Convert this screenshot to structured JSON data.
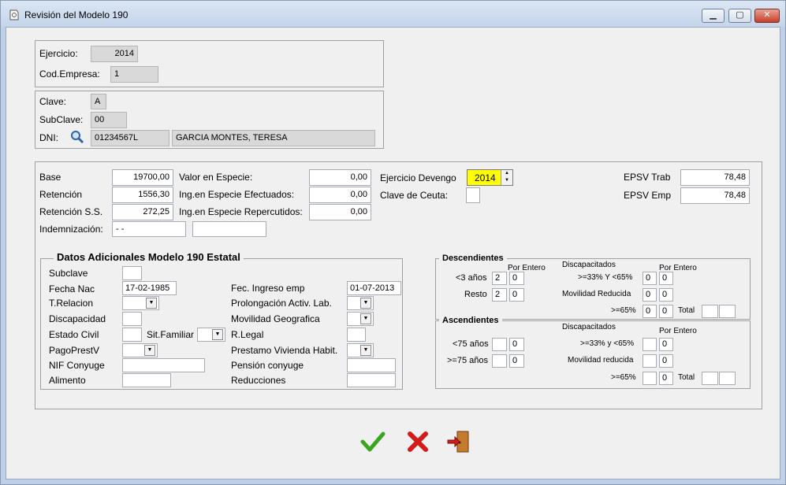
{
  "window": {
    "title": "Revisión del Modelo 190"
  },
  "header": {
    "ejercicio_label": "Ejercicio:",
    "ejercicio_value": "2014",
    "cod_empresa_label": "Cod.Empresa:",
    "cod_empresa_value": "1"
  },
  "perceptor": {
    "clave_label": "Clave:",
    "clave_value": "A",
    "subclave_label": "SubClave:",
    "subclave_value": "00",
    "dni_label": "DNI:",
    "dni_value": "01234567L",
    "nombre_value": "GARCIA MONTES, TERESA"
  },
  "importes": {
    "base_label": "Base",
    "base_value": "19700,00",
    "retencion_label": "Retención",
    "retencion_value": "1556,30",
    "retencion_ss_label": "Retención S.S.",
    "retencion_ss_value": "272,25",
    "indemnizacion_label": "Indemnización:",
    "indemnizacion_value": "- -",
    "indemnizacion_value2": "",
    "valor_especie_label": "Valor en Especie:",
    "valor_especie_value": "0,00",
    "ing_efectuados_label": "Ing.en Especie Efectuados:",
    "ing_efectuados_value": "0,00",
    "ing_repercutidos_label": "Ing.en Especie Repercutidos:",
    "ing_repercutidos_value": "0,00",
    "ejercicio_devengo_label": "Ejercicio Devengo",
    "ejercicio_devengo_value": "2014",
    "clave_ceuta_label": "Clave de Ceuta:",
    "clave_ceuta_value": "",
    "epsv_trab_label": "EPSV Trab",
    "epsv_trab_value": "78,48",
    "epsv_emp_label": "EPSV Emp",
    "epsv_emp_value": "78,48"
  },
  "datos_adicionales": {
    "title": "Datos Adicionales Modelo 190 Estatal",
    "subclave_label": "Subclave",
    "subclave_value": "",
    "fecha_nac_label": "Fecha Nac",
    "fecha_nac_value": "17-02-1985",
    "t_relacion_label": "T.Relacion",
    "t_relacion_value": "",
    "discapacidad_label": "Discapacidad",
    "discapacidad_value": "",
    "estado_civil_label": "Estado Civil",
    "estado_civil_value": "",
    "sit_familiar_label": "Sit.Familiar",
    "sit_familiar_value": "",
    "pago_prest_label": "PagoPrestV",
    "pago_prest_value": "",
    "nif_conyuge_label": "NIF Conyuge",
    "nif_conyuge_value": "",
    "alimento_label": "Alimento",
    "alimento_value": "",
    "fec_ingreso_label": "Fec. Ingreso emp",
    "fec_ingreso_value": "01-07-2013",
    "prolongacion_label": "Prolongación Activ. Lab.",
    "prolongacion_value": "",
    "movilidad_label": "Movilidad Geografica",
    "movilidad_value": "",
    "r_legal_label": "R.Legal",
    "r_legal_value": "",
    "prestamo_label": "Prestamo Vivienda Habit.",
    "prestamo_value": "",
    "pension_label": "Pensión conyuge",
    "pension_value": "",
    "reducciones_label": "Reducciones",
    "reducciones_value": ""
  },
  "descendientes": {
    "title": "Descendientes",
    "por_entero_label": "Por Entero",
    "discapacitados_label": "Discapacitados",
    "por_entero_label2": "Por Entero",
    "menor3_label": "<3 años",
    "menor3_value": "2",
    "menor3_entero": "0",
    "resto_label": "Resto",
    "resto_value": "2",
    "resto_entero": "0",
    "d33_label": ">=33% Y <65%",
    "d33_value": "0",
    "d33_entero": "0",
    "movilidad_label": "Movilidad Reducida",
    "movilidad_value": "0",
    "movilidad_entero": "0",
    "d65_label": ">=65%",
    "d65_value": "0",
    "d65_entero": "0",
    "total_label": "Total",
    "total_value1": "",
    "total_value2": ""
  },
  "ascendientes": {
    "title": "Ascendientes",
    "discapacitados_label": "Discapacitados",
    "por_entero_label": "Por Entero",
    "menor75_label": "<75 años",
    "menor75_value": "",
    "menor75_entero": "0",
    "mayor75_label": ">=75 años",
    "mayor75_value": "",
    "mayor75_entero": "0",
    "d33_label": ">=33% y <65%",
    "d33_value": "",
    "d33_entero": "0",
    "movilidad_label": "Movilidad reducida",
    "movilidad_value": "",
    "movilidad_entero": "0",
    "d65_label": ">=65%",
    "d65_value": "",
    "d65_entero": "0",
    "total_label": "Total",
    "total_value1": "",
    "total_value2": ""
  },
  "icons": {
    "accept": "check-icon",
    "cancel": "cross-icon",
    "exit": "exit-door-icon",
    "search": "magnifier-icon"
  },
  "colors": {
    "highlight": "#ffff00",
    "accept": "#3aa51f",
    "cancel": "#d21b1b",
    "window_frame": "#bdd0e7"
  }
}
